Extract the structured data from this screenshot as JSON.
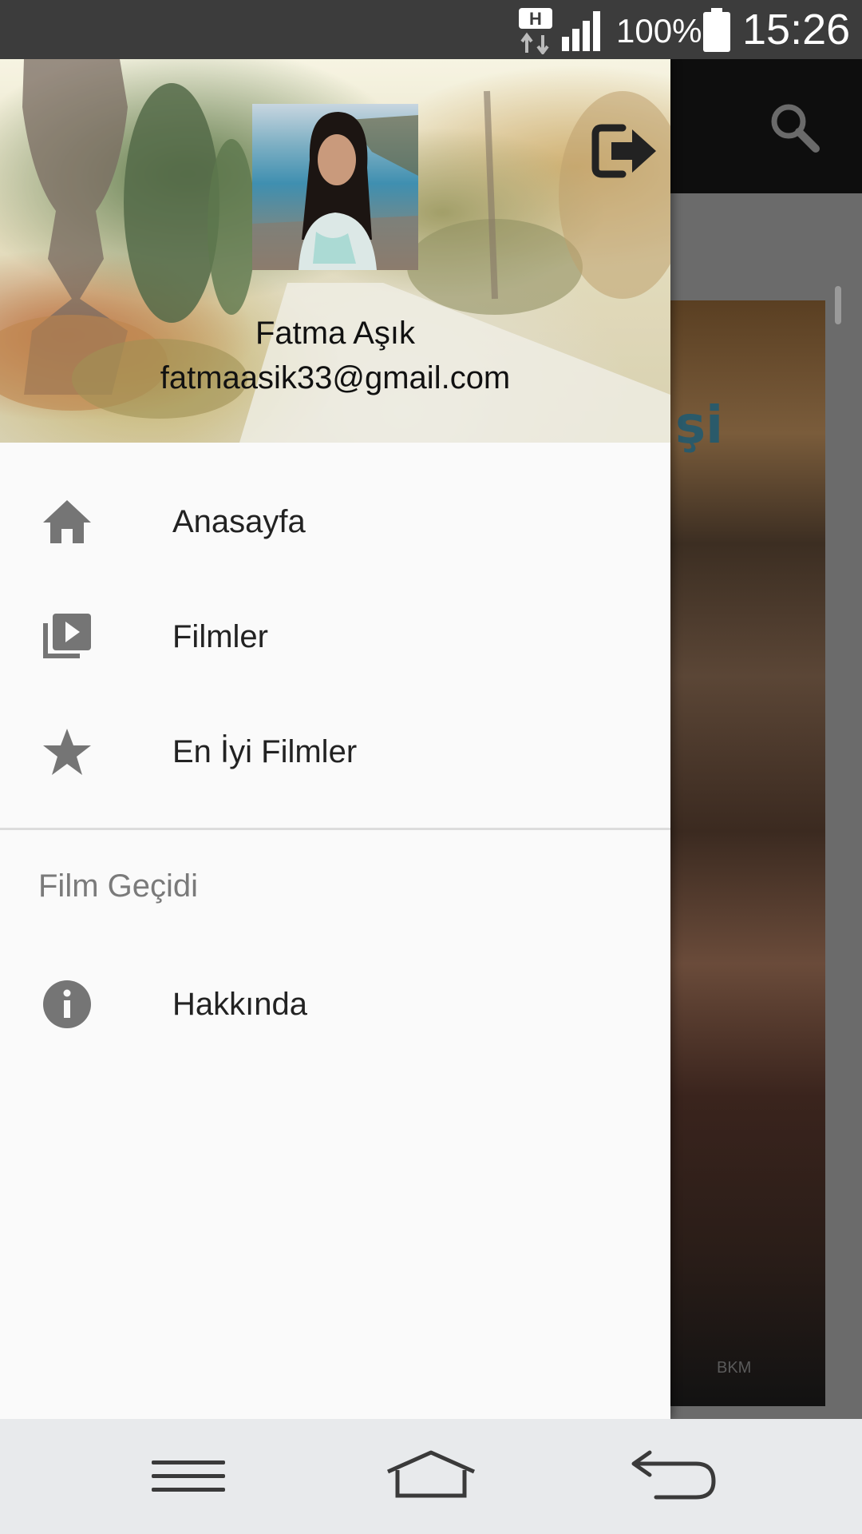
{
  "status_bar": {
    "network_type": "H",
    "battery_percent": "100%",
    "time": "15:26"
  },
  "user": {
    "name": "Fatma Aşık",
    "email": "fatmaasik33@gmail.com"
  },
  "menu": {
    "items": [
      {
        "label": "Anasayfa",
        "icon": "home-icon"
      },
      {
        "label": "Filmler",
        "icon": "video-library-icon"
      },
      {
        "label": "En İyi Filmler",
        "icon": "star-icon"
      }
    ],
    "section_title": "Film Geçidi",
    "section_items": [
      {
        "label": "Hakkında",
        "icon": "info-icon"
      }
    ]
  },
  "icons": {
    "toolbar": [
      "search-icon"
    ],
    "header": [
      "logout-icon"
    ],
    "navigation": [
      "menu-lines-icon",
      "home-outline-icon",
      "back-arrow-icon"
    ]
  },
  "colors": {
    "status_bar": "#3c3c3c",
    "drawer_background": "#fafafa",
    "menu_icon": "#757575",
    "menu_text": "#222222",
    "section_title": "#7a7a7a",
    "nav_bar": "#e8eaec",
    "toolbar": "#0e0e0e"
  }
}
